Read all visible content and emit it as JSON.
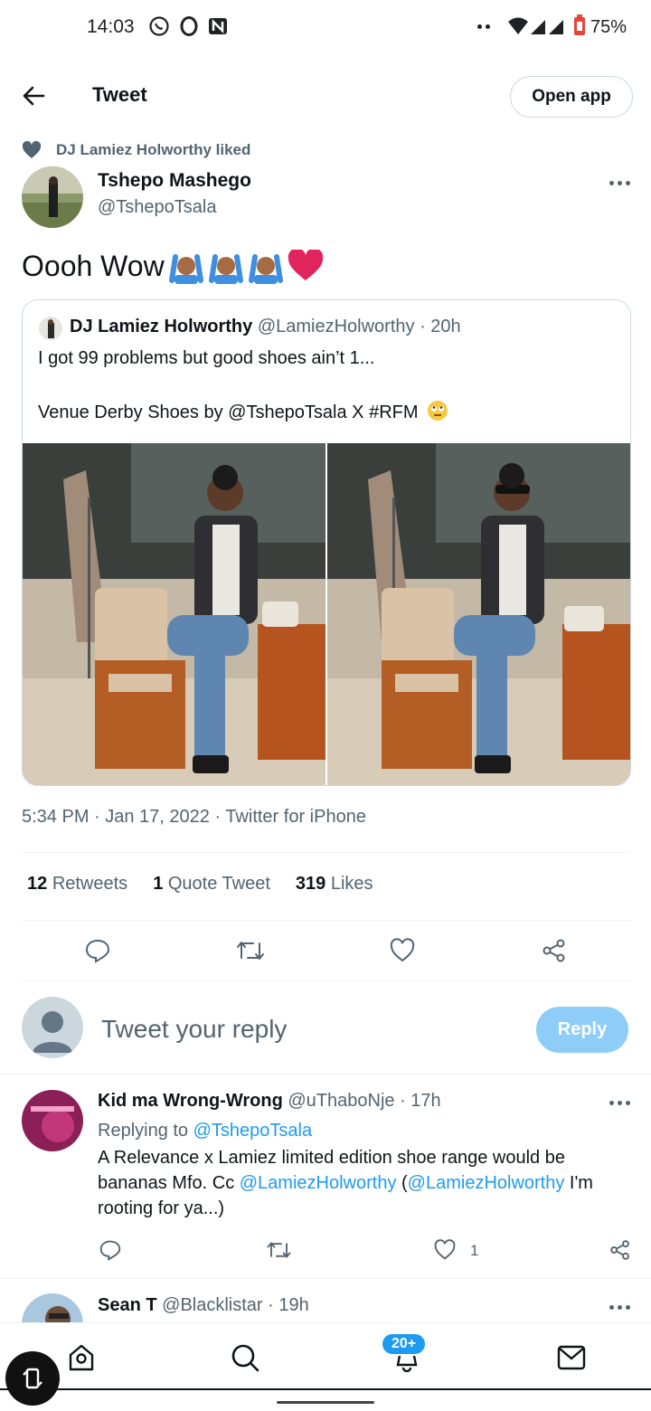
{
  "status_bar": {
    "time": "14:03",
    "battery": "75%"
  },
  "header": {
    "title": "Tweet",
    "open_app_label": "Open app"
  },
  "social_context": {
    "liked_by": "DJ Lamiez Holworthy",
    "action": "liked"
  },
  "tweet": {
    "author_name": "Tshepo Mashego",
    "author_handle": "@TshepoTsala",
    "text": "Oooh Wow",
    "timestamp": "5:34 PM · Jan 17, 2022 · Twitter for iPhone",
    "retweets_count": "12",
    "retweets_label": "Retweets",
    "quotes_count": "1",
    "quotes_label": "Quote Tweet",
    "likes_count": "319",
    "likes_label": "Likes"
  },
  "quoted_tweet": {
    "author_name": "DJ Lamiez Holworthy",
    "author_handle": "@LamiezHolworthy",
    "age": "· 20h",
    "line1": "I got 99 problems but good shoes ain’t 1...",
    "line2": "Venue Derby Shoes by @TshepoTsala X #RFM"
  },
  "reply_composer": {
    "placeholder": "Tweet your reply",
    "reply_label": "Reply"
  },
  "replies": [
    {
      "author_name": "Kid ma Wrong-Wrong",
      "author_handle": "@uThaboNje",
      "age": "· 17h",
      "replying_to_label": "Replying to",
      "replying_to_handle": "@TshepoTsala",
      "text_line1": "A Relevance x Lamiez limited edition shoe range would be",
      "text_line2_a": "bananas Mfo. Cc ",
      "text_line2_mention1": "@LamiezHolworthy",
      "text_line2_b": " (",
      "text_line2_mention2": "@LamiezHolworthy",
      "text_line2_c": " I'm",
      "text_line3": "rooting for ya...)",
      "likes": "1"
    },
    {
      "author_name": "Sean T",
      "author_handle": "@Blacklistar",
      "age": "· 19h"
    }
  ],
  "bottom_nav": {
    "notifications_badge": "20+"
  },
  "colors": {
    "accent": "#1d9bf0",
    "reply_disabled": "#8ecdf8",
    "heart": "#e0245e"
  }
}
